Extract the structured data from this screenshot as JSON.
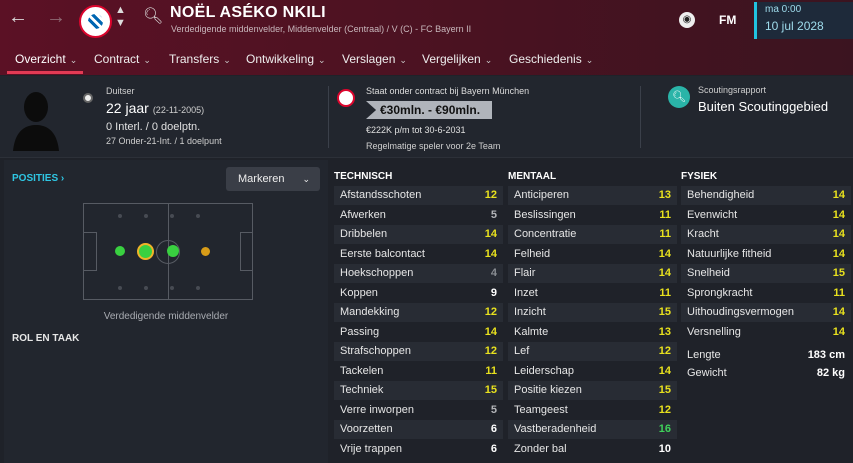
{
  "header": {
    "player_name": "NOËL ASÉKO NKILI",
    "subtitle": "Verdedigende middenvelder, Middenvelder (Centraal) / V (C) - FC Bayern II",
    "fm_label": "FM",
    "time": "ma 0:00",
    "date": "10 jul 2028",
    "colors": {
      "accent": "#e33a54",
      "highlight": "#2fc6e3"
    }
  },
  "tabs": [
    {
      "label": "Overzicht",
      "active": true
    },
    {
      "label": "Contract"
    },
    {
      "label": "Transfers"
    },
    {
      "label": "Ontwikkeling"
    },
    {
      "label": "Verslagen"
    },
    {
      "label": "Vergelijken"
    },
    {
      "label": "Geschiedenis"
    }
  ],
  "profile": {
    "nationality": "Duitser",
    "age": "22 jaar",
    "dob": "(22-11-2005)",
    "international": "0 Interl. / 0 doelptn.",
    "u21": "27 Onder-21-Int. / 1 doelpunt"
  },
  "contract": {
    "text": "Staat onder contract bij Bayern München",
    "value": "€30mln. - €90mln.",
    "wage": "€222K p/m tot 30-6-2031",
    "role": "Regelmatige speler voor 2e Team"
  },
  "scouting": {
    "label": "Scoutingsrapport",
    "value": "Buiten Scoutinggebied"
  },
  "positions": {
    "link": "POSITIES",
    "button": "Markeren",
    "position_label": "Verdedigende middenvelder",
    "role_heading": "ROL EN TAAK"
  },
  "technisch": {
    "heading": "TECHNISCH",
    "items": [
      {
        "name": "Afstandsschoten",
        "value": "12"
      },
      {
        "name": "Afwerken",
        "value": "5"
      },
      {
        "name": "Dribbelen",
        "value": "14"
      },
      {
        "name": "Eerste balcontact",
        "value": "14"
      },
      {
        "name": "Hoekschoppen",
        "value": "4"
      },
      {
        "name": "Koppen",
        "value": "9"
      },
      {
        "name": "Mandekking",
        "value": "12"
      },
      {
        "name": "Passing",
        "value": "14"
      },
      {
        "name": "Strafschoppen",
        "value": "12"
      },
      {
        "name": "Tackelen",
        "value": "11"
      },
      {
        "name": "Techniek",
        "value": "15"
      },
      {
        "name": "Verre inworpen",
        "value": "5"
      },
      {
        "name": "Voorzetten",
        "value": "6"
      },
      {
        "name": "Vrije trappen",
        "value": "6"
      }
    ]
  },
  "mentaal": {
    "heading": "MENTAAL",
    "items": [
      {
        "name": "Anticiperen",
        "value": "13"
      },
      {
        "name": "Beslissingen",
        "value": "11"
      },
      {
        "name": "Concentratie",
        "value": "11"
      },
      {
        "name": "Felheid",
        "value": "14"
      },
      {
        "name": "Flair",
        "value": "14"
      },
      {
        "name": "Inzet",
        "value": "11"
      },
      {
        "name": "Inzicht",
        "value": "15"
      },
      {
        "name": "Kalmte",
        "value": "13"
      },
      {
        "name": "Lef",
        "value": "12"
      },
      {
        "name": "Leiderschap",
        "value": "14"
      },
      {
        "name": "Positie kiezen",
        "value": "15"
      },
      {
        "name": "Teamgeest",
        "value": "12"
      },
      {
        "name": "Vastberadenheid",
        "value": "16"
      },
      {
        "name": "Zonder bal",
        "value": "10"
      }
    ]
  },
  "fysiek": {
    "heading": "FYSIEK",
    "items": [
      {
        "name": "Behendigheid",
        "value": "14"
      },
      {
        "name": "Evenwicht",
        "value": "14"
      },
      {
        "name": "Kracht",
        "value": "14"
      },
      {
        "name": "Natuurlijke fitheid",
        "value": "14"
      },
      {
        "name": "Snelheid",
        "value": "15"
      },
      {
        "name": "Sprongkracht",
        "value": "11"
      },
      {
        "name": "Uithoudingsvermogen",
        "value": "14"
      },
      {
        "name": "Versnelling",
        "value": "14"
      }
    ],
    "lengte": {
      "name": "Lengte",
      "value": "183 cm"
    },
    "gewicht": {
      "name": "Gewicht",
      "value": "82 kg"
    }
  }
}
